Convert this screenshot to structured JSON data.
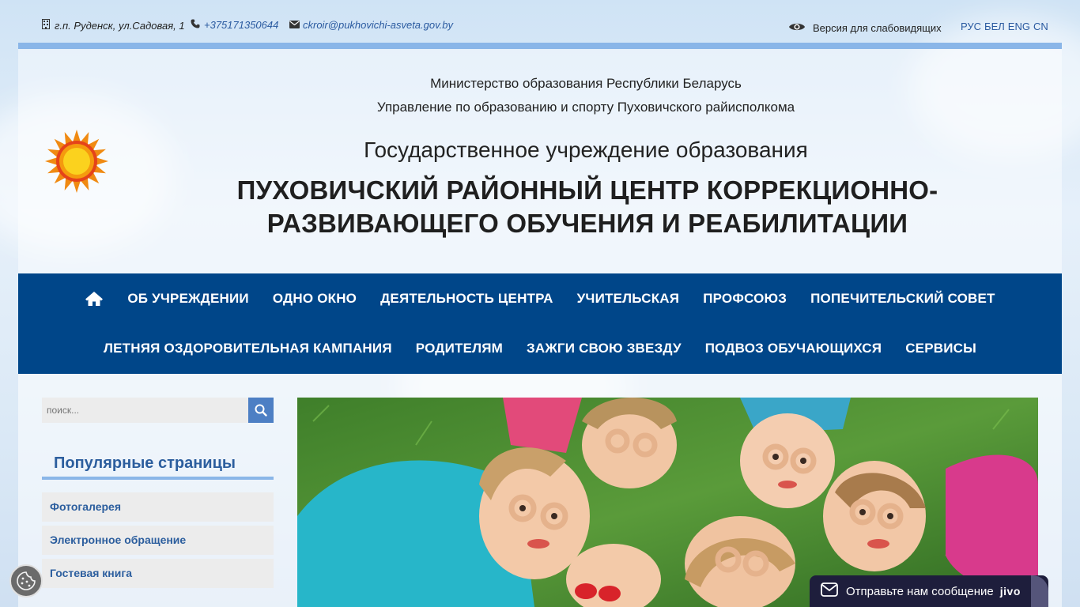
{
  "topbar": {
    "address": "г.п. Руденск, ул.Садовая, 1",
    "phone": "+375171350644",
    "email": "ckroir@pukhovichi-asveta.gov.by",
    "visually_impaired": "Версия для слабовидящих",
    "languages": [
      "РУС",
      "БЕЛ",
      "ENG",
      "CN"
    ]
  },
  "header": {
    "ministry": "Министерство образования Республики Беларусь",
    "department": "Управление по образованию и спорту Пуховичского райисполкома",
    "subtitle": "Государственное учреждение образования",
    "title": "ПУХОВИЧСКИЙ РАЙОННЫЙ ЦЕНТР КОРРЕКЦИОННО-РАЗВИВАЮЩЕГО ОБУЧЕНИЯ И РЕАБИЛИТАЦИИ"
  },
  "nav": {
    "row1": [
      "ОБ УЧРЕЖДЕНИИ",
      "ОДНО ОКНО",
      "ДЕЯТЕЛЬНОСТЬ ЦЕНТРА",
      "УЧИТЕЛЬСКАЯ",
      "ПРОФСОЮЗ",
      "ПОПЕЧИТЕЛЬСКИЙ СОВЕТ"
    ],
    "row2": [
      "ЛЕТНЯЯ ОЗДОРОВИТЕЛЬНАЯ КАМПАНИЯ",
      "РОДИТЕЛЯМ",
      "ЗАЖГИ СВОЮ ЗВЕЗДУ",
      "ПОДВОЗ ОБУЧАЮЩИХСЯ",
      "СЕРВИСЫ"
    ]
  },
  "search": {
    "placeholder": "поиск..."
  },
  "popular": {
    "title": "Популярные страницы",
    "items": [
      "Фотогалерея",
      "Электронное обращение",
      "Гостевая книга"
    ]
  },
  "chat": {
    "label": "Отправьте нам сообщение",
    "brand": "jivo"
  },
  "colors": {
    "nav_bg": "#004689",
    "accent": "#8ab6e8",
    "link": "#2c5e9e",
    "search_btn": "#4d7fc4"
  }
}
